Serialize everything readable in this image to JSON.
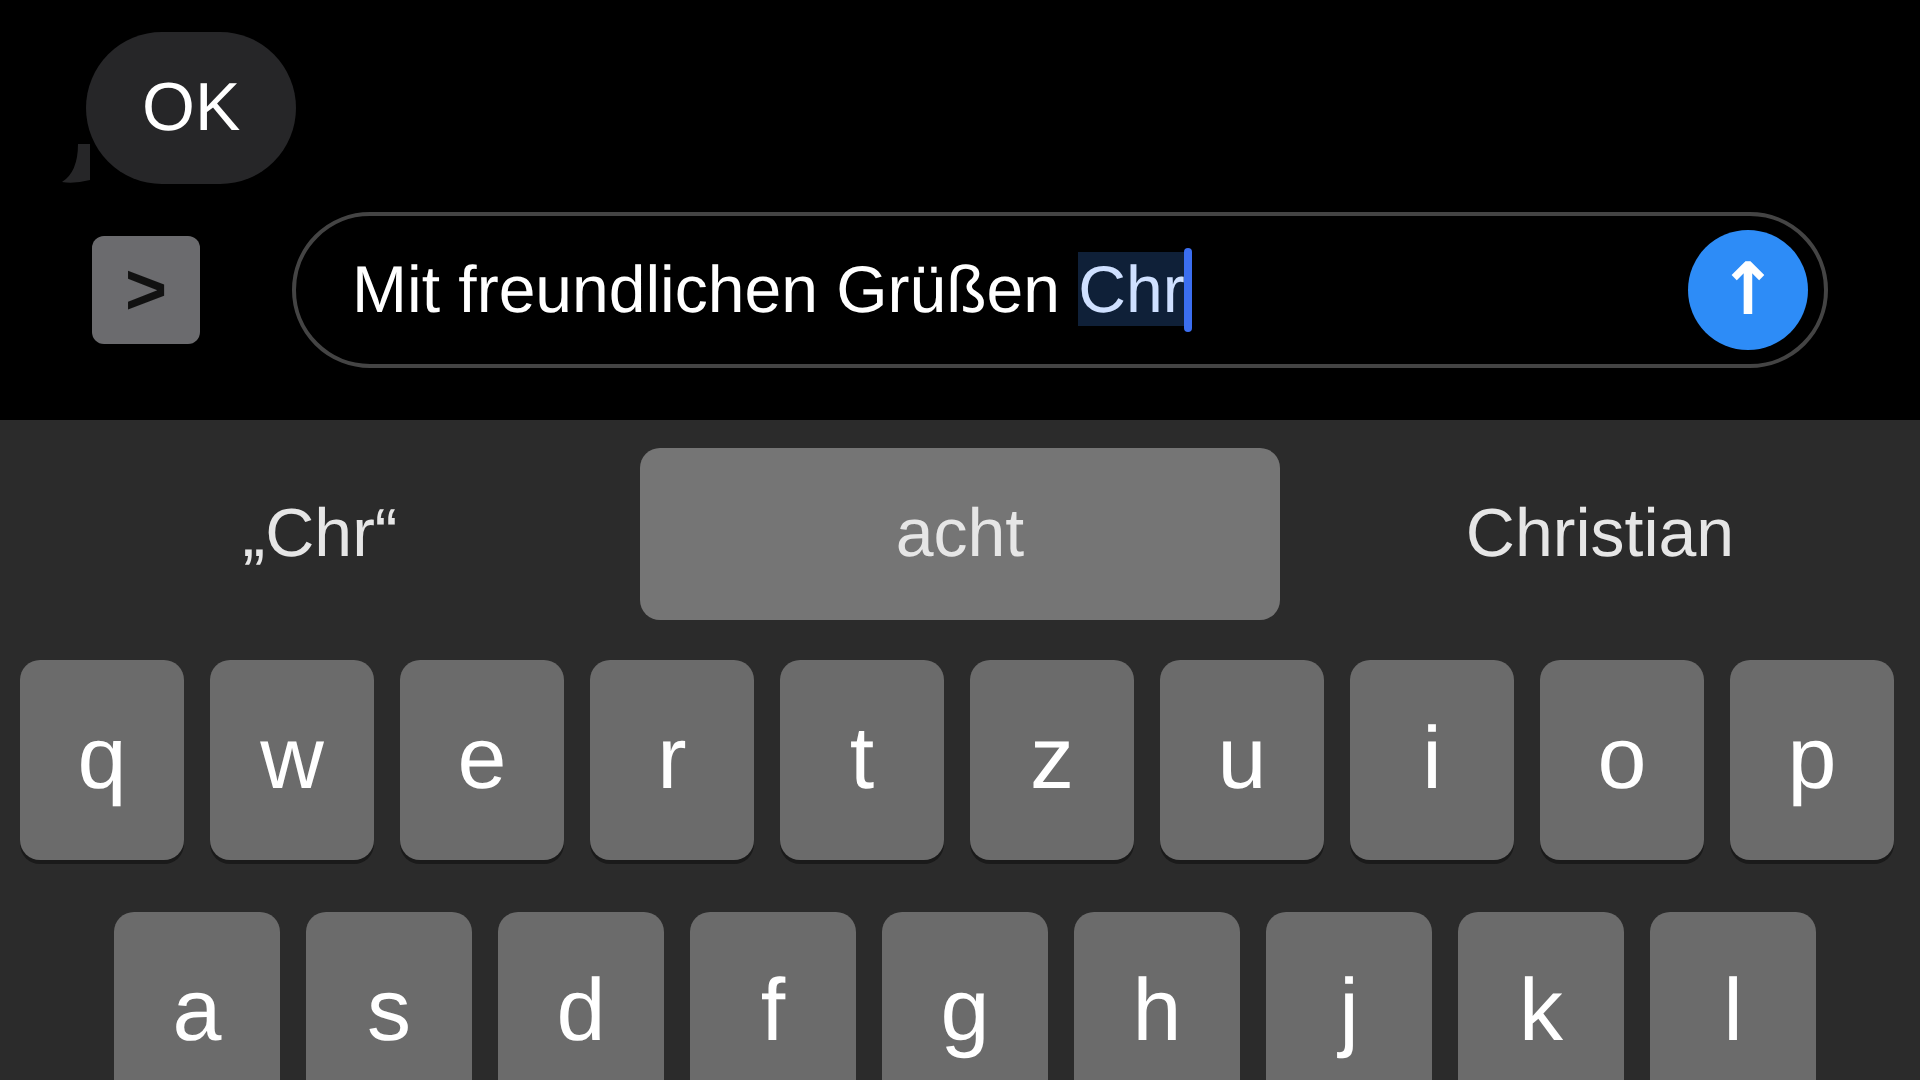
{
  "conversation": {
    "messages": [
      {
        "text": "OK",
        "incoming": true
      }
    ]
  },
  "compose": {
    "expand_button": ">",
    "value": "Mit freundlichen Grüßen",
    "marked_text": "Chr",
    "cursor": true,
    "send_button": "↑"
  },
  "suggestions": [
    {
      "label": "„Chr“",
      "selected": false
    },
    {
      "label": "acht",
      "selected": true
    },
    {
      "label": "Christian",
      "selected": false
    }
  ],
  "keyboard": {
    "rows": [
      [
        "q",
        "w",
        "e",
        "r",
        "t",
        "z",
        "u",
        "i",
        "o",
        "p"
      ],
      [
        "a",
        "s",
        "d",
        "f",
        "g",
        "h",
        "j",
        "k",
        "l"
      ]
    ]
  }
}
